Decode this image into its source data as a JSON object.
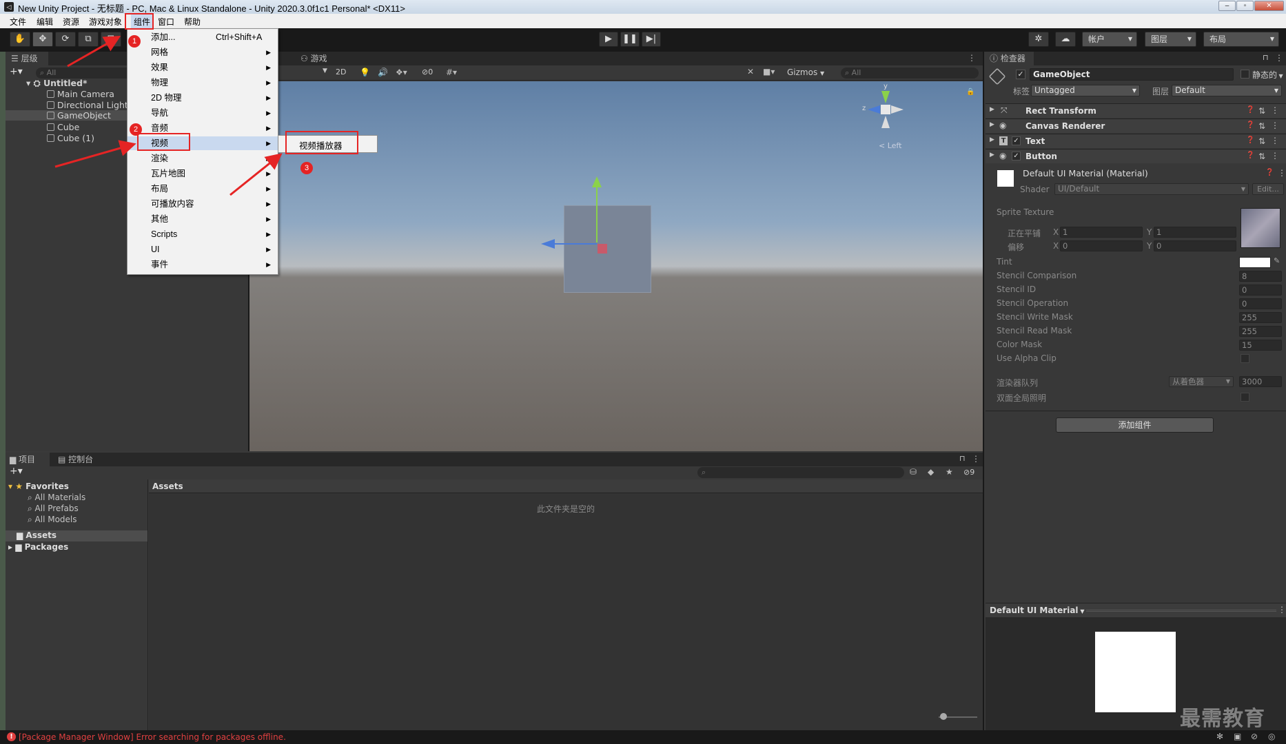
{
  "window": {
    "title": "New Unity Project - 无标题 - PC, Mac & Linux Standalone - Unity 2020.3.0f1c1 Personal* <DX11>"
  },
  "menubar": {
    "items": [
      "文件",
      "编辑",
      "资源",
      "游戏对象",
      "组件",
      "窗口",
      "帮助"
    ]
  },
  "toolbar": {
    "account": "帐户",
    "layers": "图层",
    "layout": "布局"
  },
  "hierarchy": {
    "tab": "层级",
    "search_placeholder": "All",
    "scene": "Untitled*",
    "items": [
      "Main Camera",
      "Directional Light",
      "GameObject",
      "Cube",
      "Cube (1)"
    ]
  },
  "scene": {
    "tab_game": "游戏",
    "btn_2d": "2D",
    "hidden_count": "0",
    "gizmos": "Gizmos",
    "search": "All",
    "orientation": "< Left",
    "axis_y": "y",
    "axis_z": "z"
  },
  "component_menu": {
    "add_label": "添加...",
    "add_shortcut": "Ctrl+Shift+A",
    "items": [
      "网格",
      "效果",
      "物理",
      "2D 物理",
      "导航",
      "音频",
      "视频",
      "渲染",
      "瓦片地图",
      "布局",
      "可播放内容",
      "其他",
      "Scripts",
      "UI",
      "事件"
    ]
  },
  "video_submenu": {
    "item": "视频播放器"
  },
  "annotations": [
    "1",
    "2",
    "3"
  ],
  "project": {
    "tab_project": "项目",
    "tab_console": "控制台",
    "favorites": "Favorites",
    "fav_items": [
      "All Materials",
      "All Prefabs",
      "All Models"
    ],
    "assets": "Assets",
    "packages": "Packages",
    "breadcrumb": "Assets",
    "empty_text": "此文件夹是空的",
    "hidden_count": "9"
  },
  "inspector": {
    "tab": "检查器",
    "object_name": "GameObject",
    "static_label": "静态的",
    "tag_label": "标签",
    "tag_value": "Untagged",
    "layer_label": "图层",
    "layer_value": "Default",
    "components": [
      "Rect Transform",
      "Canvas Renderer",
      "Text",
      "Button"
    ],
    "material_name": "Default UI Material (Material)",
    "shader_label": "Shader",
    "shader_value": "UI/Default",
    "edit_btn": "Edit...",
    "sprite_texture": "Sprite Texture",
    "tiling": {
      "label": "正在平铺",
      "x": "1",
      "y": "1"
    },
    "offset": {
      "label": "偏移",
      "x": "0",
      "y": "0"
    },
    "props": [
      {
        "label": "Tint",
        "value": ""
      },
      {
        "label": "Stencil Comparison",
        "value": "8"
      },
      {
        "label": "Stencil ID",
        "value": "0"
      },
      {
        "label": "Stencil Operation",
        "value": "0"
      },
      {
        "label": "Stencil Write Mask",
        "value": "255"
      },
      {
        "label": "Stencil Read Mask",
        "value": "255"
      },
      {
        "label": "Color Mask",
        "value": "15"
      },
      {
        "label": "Use Alpha Clip",
        "value": ""
      }
    ],
    "render_queue_label": "渲染器队列",
    "render_queue_mode": "从着色器",
    "render_queue_value": "3000",
    "double_sided_label": "双面全局照明",
    "add_component": "添加组件",
    "preview_title": "Default UI Material",
    "axis_x": "X",
    "axis_y": "Y"
  },
  "status": {
    "error": "[Package Manager Window] Error searching for packages offline."
  },
  "watermark": "最需教育"
}
